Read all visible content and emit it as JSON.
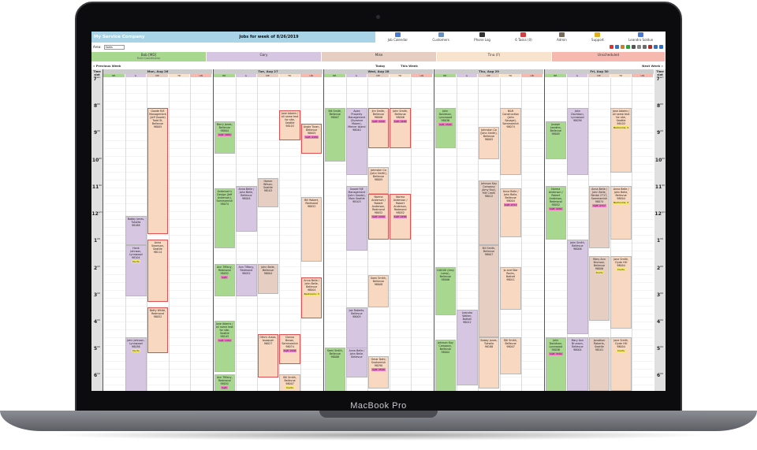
{
  "device": {
    "brand": "MacBook Pro"
  },
  "header": {
    "company": "My Service Company",
    "jobs_title": "Jobs for week of 8/26/2019",
    "nav": [
      {
        "label": "Job Calendar",
        "icon": "calendar-icon",
        "color": "#4a7bd0"
      },
      {
        "label": "Customers",
        "icon": "customers-icon",
        "color": "#6a8fc0"
      },
      {
        "label": "Phone Log",
        "icon": "phone-icon",
        "color": "#333333"
      },
      {
        "label": "6 Tasks (0)",
        "icon": "tasks-icon",
        "color": "#d04040"
      },
      {
        "label": "Admin",
        "icon": "admin-icon",
        "color": "#7a6a5a"
      },
      {
        "label": "Support",
        "icon": "support-icon",
        "color": "#e0b020"
      },
      {
        "label": "Leandro Soldun",
        "icon": "user-icon",
        "color": "#4a7bd0"
      }
    ]
  },
  "toolbar": {
    "area_label": "Area:",
    "area_value": "Sales",
    "tools": [
      {
        "icon": "youtube-icon",
        "color": "#e03030"
      },
      {
        "icon": "map-icon",
        "color": "#3a70c0"
      },
      {
        "icon": "help-icon",
        "color": "#d08020"
      },
      {
        "icon": "dollar-icon",
        "color": "#30a040"
      },
      {
        "icon": "print-icon",
        "color": "#555555"
      },
      {
        "icon": "copy-icon",
        "color": "#888888"
      },
      {
        "icon": "grid-icon",
        "color": "#6a6a6a"
      },
      {
        "icon": "settings-icon",
        "color": "#aa3030"
      },
      {
        "icon": "info-icon",
        "color": "#3070c0"
      },
      {
        "icon": "refresh-icon",
        "color": "#3070c0"
      }
    ]
  },
  "employees": [
    {
      "name": "Bob [MD]",
      "sub": "Field Coordinator",
      "color": "#a8d890"
    },
    {
      "name": "Gary",
      "sub": "",
      "color": "#d7c6e2"
    },
    {
      "name": "Mike",
      "sub": "",
      "color": "#e6cfc2"
    },
    {
      "name": "Tina (F)",
      "sub": "",
      "color": "#f8e3cf"
    },
    {
      "name": "Unscheduled",
      "sub": "",
      "color": "#f7b8b0"
    }
  ],
  "weeknav": {
    "previous": "« Previous Week",
    "today": "Today",
    "this_week": "This Week",
    "next": "Next Week »"
  },
  "days": [
    {
      "label": "Mon, Aug 26"
    },
    {
      "label": "Tue, Aug 27"
    },
    {
      "label": "Wed, Aug 28"
    },
    {
      "label": "Thu, Aug 29"
    },
    {
      "label": "Fri, Aug 30"
    }
  ],
  "subcols": [
    "BB",
    "G",
    "ME",
    "TR",
    "UN"
  ],
  "time_slot_label": "Time slot",
  "hours": [
    {
      "h": "7",
      "ap": "am"
    },
    {
      "h": "8",
      "ap": "00"
    },
    {
      "h": "9",
      "ap": "00"
    },
    {
      "h": "10",
      "ap": "00"
    },
    {
      "h": "11",
      "ap": "00"
    },
    {
      "h": "12",
      "ap": "pm"
    },
    {
      "h": "1",
      "ap": "00"
    },
    {
      "h": "2",
      "ap": "00"
    },
    {
      "h": "3",
      "ap": "00"
    },
    {
      "h": "4",
      "ap": "00"
    },
    {
      "h": "5",
      "ap": "00"
    },
    {
      "h": "6",
      "ap": "00"
    }
  ],
  "jobs": [
    {
      "day": 0,
      "col": 2,
      "start": 1.1,
      "end": 5.8,
      "color": "#f8d8c0",
      "border": "#e05050",
      "text": "Goode R/E Management (Jeff Goode) Todd St, Bellevue 98005",
      "tag": ""
    },
    {
      "day": 0,
      "col": 1,
      "start": 5.1,
      "end": 6.2,
      "color": "#d7c6e2",
      "border": "",
      "text": "Bobby Jones, Tukwila 98188",
      "tag": ""
    },
    {
      "day": 0,
      "col": 2,
      "start": 6.0,
      "end": 8.3,
      "color": "#f8d8c0",
      "border": "#e05050",
      "text": "Anna Swanson, Seattle 98114",
      "tag": ""
    },
    {
      "day": 0,
      "col": 1,
      "start": 6.2,
      "end": 8.1,
      "color": "#d7c6e2",
      "border": "",
      "text": "Hank Johnson, Lynnwood 98104",
      "tag": "Ducts"
    },
    {
      "day": 0,
      "col": 2,
      "start": 8.5,
      "end": 10.2,
      "color": "#f8d8c0",
      "border": "#e05050",
      "text": "Betty White, Redmond 98052",
      "tag": ""
    },
    {
      "day": 0,
      "col": 1,
      "start": 9.6,
      "end": 12.0,
      "color": "#d7c6e2",
      "border": "",
      "text": "John Johnson, Lynnwood 98036",
      "tag": "Ducts"
    },
    {
      "day": 1,
      "col": 0,
      "start": 1.6,
      "end": 2.8,
      "color": "#a8d890",
      "border": "",
      "text": "Barry Jones, Bellevue 98004",
      "tag": "Sqft: 1850"
    },
    {
      "day": 1,
      "col": 3,
      "start": 1.2,
      "end": 2.3,
      "color": "#f8d8c0",
      "border": "#e05050",
      "text": "Jose Adams / all name text for site, Seattle 98103",
      "tag": ""
    },
    {
      "day": 1,
      "col": 4,
      "start": 1.7,
      "end": 2.8,
      "color": "#f8d8c0",
      "border": "#e05050",
      "text": "Angie Turan, Bellevue 98005",
      "tag": "Sqft: 2150"
    },
    {
      "day": 1,
      "col": 2,
      "start": 3.7,
      "end": 4.8,
      "color": "#e6cfc2",
      "border": "",
      "text": "Homer Wilson, Seattle 98103",
      "tag": ""
    },
    {
      "day": 1,
      "col": 0,
      "start": 4.1,
      "end": 6.3,
      "color": "#a8d890",
      "border": "",
      "text": "Anderson's Design (Jeff Anderson), Sammamish 98074",
      "tag": ""
    },
    {
      "day": 1,
      "col": 1,
      "start": 4.0,
      "end": 5.7,
      "color": "#d7c6e2",
      "border": "",
      "text": "Anna Belle / John Belle, Bellevue 98004",
      "tag": ""
    },
    {
      "day": 1,
      "col": 4,
      "start": 4.4,
      "end": 6.8,
      "color": "#f8d8c0",
      "border": "",
      "text": "Bill Robert, Redmond 98052",
      "tag": ""
    },
    {
      "day": 1,
      "col": 0,
      "start": 6.9,
      "end": 8.1,
      "color": "#a8d890",
      "border": "",
      "text": "Ann Tiffany, Redmond 98052",
      "tag": "Sqft:"
    },
    {
      "day": 1,
      "col": 1,
      "start": 6.9,
      "end": 8.1,
      "color": "#d7c6e2",
      "border": "",
      "text": "Ann Tiffany, Redmond 98052",
      "tag": ""
    },
    {
      "day": 1,
      "col": 2,
      "start": 6.9,
      "end": 8.0,
      "color": "#e6cfc2",
      "border": "",
      "text": "John Belle, Bellevue 98004",
      "tag": ""
    },
    {
      "day": 1,
      "col": 4,
      "start": 7.4,
      "end": 8.9,
      "color": "#f8d8c0",
      "border": "#e05050",
      "text": "Anna Belle / John Belle, Bellevue 98004",
      "tag": "Bedrooms: 3"
    },
    {
      "day": 1,
      "col": 0,
      "start": 9.0,
      "end": 10.9,
      "color": "#a8d890",
      "border": "",
      "text": "Jose Adams / all name text for site, Seattle 98103",
      "tag": "Sqft: 1350"
    },
    {
      "day": 1,
      "col": 2,
      "start": 9.5,
      "end": 11.1,
      "color": "#f8d8c0",
      "border": "#e05050",
      "text": "Otto's Autos, Issaquah 98027",
      "tag": ""
    },
    {
      "day": 1,
      "col": 3,
      "start": 9.5,
      "end": 10.6,
      "color": "#f8d8c0",
      "border": "#e05050",
      "text": "Donna Brown, Sammamish 98074",
      "tag": "Sqft: 2200"
    },
    {
      "day": 1,
      "col": 0,
      "start": 11.0,
      "end": 12.3,
      "color": "#a8d890",
      "border": "",
      "text": "Ann Tiffany, Redmond 98052",
      "tag": "Sqft:"
    },
    {
      "day": 1,
      "col": 3,
      "start": 11.0,
      "end": 12.3,
      "color": "#f8d8c0",
      "border": "",
      "text": "Bill Smith, Bellevue 98007",
      "tag": "Ducts"
    },
    {
      "day": 2,
      "col": 0,
      "start": 1.1,
      "end": 3.1,
      "color": "#a8d890",
      "border": "",
      "text": "Bill Smith, Bellevue 98007",
      "tag": ""
    },
    {
      "day": 2,
      "col": 1,
      "start": 1.1,
      "end": 3.6,
      "color": "#d7c6e2",
      "border": "",
      "text": "Apex Property Management (Suzanne Moore), Mercer Island 98040",
      "tag": ""
    },
    {
      "day": 2,
      "col": 2,
      "start": 1.1,
      "end": 2.6,
      "color": "#f8d8c0",
      "border": "#e05050",
      "text": "Jim Smith, Bellevue 98006",
      "tag": "Sqft: 3200"
    },
    {
      "day": 2,
      "col": 3,
      "start": 1.1,
      "end": 2.6,
      "color": "#f8d8c0",
      "border": "#e05050",
      "text": "John Smith, Bellevue 98006",
      "tag": "Sqft: 3200"
    },
    {
      "day": 2,
      "col": 2,
      "start": 3.3,
      "end": 4.3,
      "color": "#f8d8c0",
      "border": "",
      "text": "Johnston Co (John Smith), Bellevue 98005",
      "tag": ""
    },
    {
      "day": 2,
      "col": 1,
      "start": 4.0,
      "end": 6.4,
      "color": "#d7c6e2",
      "border": "",
      "text": "Goode R/E Management (John Goode), Main Seattle 98103",
      "tag": ""
    },
    {
      "day": 2,
      "col": 2,
      "start": 4.3,
      "end": 6.0,
      "color": "#f8d8c0",
      "border": "#e05050",
      "text": "Norma Anderson / Robert Anderson, Redmond 98052",
      "tag": "Sqft: 2200"
    },
    {
      "day": 2,
      "col": 3,
      "start": 4.3,
      "end": 6.0,
      "color": "#f8d8c0",
      "border": "#e05050",
      "text": "Norma Anderson / Robert Anderson, Redmond 98052",
      "tag": "Sqft: 2200"
    },
    {
      "day": 2,
      "col": 2,
      "start": 7.3,
      "end": 8.5,
      "color": "#f8d8c0",
      "border": "",
      "text": "Sami Smith, Bellevue 98008",
      "tag": ""
    },
    {
      "day": 2,
      "col": 1,
      "start": 8.5,
      "end": 10.4,
      "color": "#d7c6e2",
      "border": "",
      "text": "Joe Roberts, Bellevue 98005",
      "tag": ""
    },
    {
      "day": 2,
      "col": 0,
      "start": 10.0,
      "end": 12.2,
      "color": "#a8d890",
      "border": "",
      "text": "Sami Smith, Bellevue 98008",
      "tag": ""
    },
    {
      "day": 2,
      "col": 1,
      "start": 10.0,
      "end": 11.1,
      "color": "#d7c6e2",
      "border": "",
      "text": "Anna Belle / John Belle, Bellevue",
      "tag": ""
    },
    {
      "day": 2,
      "col": 2,
      "start": 10.3,
      "end": 11.5,
      "color": "#f8d8c0",
      "border": "",
      "text": "Omar Dahl, Snohomish 98290",
      "tag": "Sqft: 2500"
    },
    {
      "day": 3,
      "col": 0,
      "start": 1.1,
      "end": 2.6,
      "color": "#a8d890",
      "border": "",
      "text": "John Davidson, Lynnwood 98036",
      "tag": "Sqft: 2500"
    },
    {
      "day": 3,
      "col": 2,
      "start": 1.8,
      "end": 3.0,
      "color": "#f8d8c0",
      "border": "",
      "text": "Johnston Co (John Smith), Bellevue 98005",
      "tag": ""
    },
    {
      "day": 3,
      "col": 3,
      "start": 1.1,
      "end": 3.6,
      "color": "#f8d8c0",
      "border": "",
      "text": "B&R Construction (John Savage), Sammamish 98074",
      "tag": ""
    },
    {
      "day": 3,
      "col": 2,
      "start": 3.8,
      "end": 6.2,
      "color": "#e6cfc2",
      "border": "",
      "text": "Johnson Kay Company (Amy Kay), Mill Creek 98012",
      "tag": ""
    },
    {
      "day": 3,
      "col": 3,
      "start": 4.1,
      "end": 5.9,
      "color": "#f8d8c0",
      "border": "",
      "text": "Anna Belle / John Belle, Bellevue 98004",
      "tag": "Sqft: 2717"
    },
    {
      "day": 3,
      "col": 0,
      "start": 7.0,
      "end": 8.8,
      "color": "#a8d890",
      "border": "",
      "text": "100100 (Amy Lamp), Bellevue 98006",
      "tag": ""
    },
    {
      "day": 3,
      "col": 2,
      "start": 6.2,
      "end": 9.6,
      "color": "#e6cfc2",
      "border": "",
      "text": "Bill Smith, Bellevue 98007",
      "tag": ""
    },
    {
      "day": 3,
      "col": 3,
      "start": 7.0,
      "end": 8.6,
      "color": "#f8d8c0",
      "border": "",
      "text": "Jo and Star Rocks, Bothell 98011",
      "tag": ""
    },
    {
      "day": 3,
      "col": 1,
      "start": 8.6,
      "end": 11.4,
      "color": "#d7c6e2",
      "border": "",
      "text": "Leandro Walker, Bothell 98012",
      "tag": ""
    },
    {
      "day": 3,
      "col": 0,
      "start": 9.7,
      "end": 12.0,
      "color": "#a8d890",
      "border": "",
      "text": "Johnson Kay Company, Bellevue 98004",
      "tag": ""
    },
    {
      "day": 3,
      "col": 2,
      "start": 9.6,
      "end": 11.5,
      "color": "#f8d8c0",
      "border": "",
      "text": "Bobby Jones, Tukwila 98188",
      "tag": ""
    },
    {
      "day": 3,
      "col": 3,
      "start": 9.6,
      "end": 11.0,
      "color": "#f8d8c0",
      "border": "",
      "text": "Bill Smith, Bellevue 98007",
      "tag": ""
    },
    {
      "day": 4,
      "col": 0,
      "start": 1.6,
      "end": 3.0,
      "color": "#a8d890",
      "border": "",
      "text": "Joseph Leaders, Bellevue 98005",
      "tag": ""
    },
    {
      "day": 4,
      "col": 1,
      "start": 1.1,
      "end": 3.6,
      "color": "#d7c6e2",
      "border": "",
      "text": "John Davidson, Lynnwood 98036",
      "tag": ""
    },
    {
      "day": 4,
      "col": 3,
      "start": 1.1,
      "end": 3.5,
      "color": "#f8d8c0",
      "border": "",
      "text": "Jose Adams / all name text for site, Seattle 98103",
      "tag": "Bedrooms: 4"
    },
    {
      "day": 4,
      "col": 0,
      "start": 4.0,
      "end": 6.0,
      "color": "#a8d890",
      "border": "",
      "text": "Norma Anderson / Robert Anderson, Redmond 98052",
      "tag": "Sqft: 4200"
    },
    {
      "day": 4,
      "col": 2,
      "start": 4.0,
      "end": 6.3,
      "color": "#e6cfc2",
      "border": "",
      "text": "Anna Belle / John Belle, Rental 2717, Sammamish 98074",
      "tag": "Sqft: 2717"
    },
    {
      "day": 4,
      "col": 3,
      "start": 4.0,
      "end": 6.0,
      "color": "#f8d8c0",
      "border": "",
      "text": "Anna Belle / John Belle, Bellevue 98004",
      "tag": "Bedrooms: 3"
    },
    {
      "day": 4,
      "col": 1,
      "start": 6.0,
      "end": 9.5,
      "color": "#d7c6e2",
      "border": "",
      "text": "John Smith, Bellevue 98006",
      "tag": ""
    },
    {
      "day": 4,
      "col": 2,
      "start": 6.6,
      "end": 9.0,
      "color": "#e6cfc2",
      "border": "",
      "text": "Mary Ann Brunson, Bellevue 98006",
      "tag": "Ducts"
    },
    {
      "day": 4,
      "col": 3,
      "start": 6.6,
      "end": 9.3,
      "color": "#f8d8c0",
      "border": "",
      "text": "Jane Smith, Clyde Hill 98004",
      "tag": "Ducts"
    },
    {
      "day": 4,
      "col": 0,
      "start": 9.6,
      "end": 12.0,
      "color": "#a8d890",
      "border": "",
      "text": "John Davidson, Lynnwood 98036",
      "tag": "Sqft: 2500"
    },
    {
      "day": 4,
      "col": 1,
      "start": 9.6,
      "end": 11.6,
      "color": "#d7c6e2",
      "border": "",
      "text": "Mary Ann Brunson, Bellevue 98004",
      "tag": ""
    },
    {
      "day": 4,
      "col": 2,
      "start": 9.6,
      "end": 11.6,
      "color": "#e6cfc2",
      "border": "",
      "text": "Jonathan Roberts, Seattle 98101",
      "tag": ""
    },
    {
      "day": 4,
      "col": 3,
      "start": 9.6,
      "end": 11.6,
      "color": "#f8d8c0",
      "border": "",
      "text": "Jane Smith, Clyde Hill 98004",
      "tag": "Ducts"
    }
  ]
}
